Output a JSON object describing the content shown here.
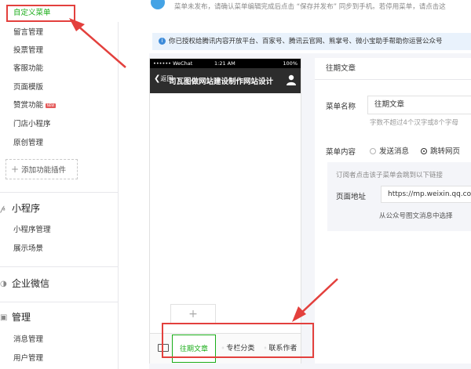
{
  "sidebar": {
    "items": [
      {
        "label": "自定义菜单",
        "active": true
      },
      {
        "label": "留言管理"
      },
      {
        "label": "投票管理"
      },
      {
        "label": "客服功能"
      },
      {
        "label": "页面模版"
      },
      {
        "label": "赞赏功能",
        "badge": "NEW"
      },
      {
        "label": "门店小程序"
      },
      {
        "label": "原创管理"
      }
    ],
    "add_plugin": "添加功能插件",
    "sections": [
      {
        "title": "小程序",
        "items": [
          "小程序管理",
          "展示场景"
        ]
      },
      {
        "title": "企业微信",
        "items": []
      },
      {
        "title": "管理",
        "items": [
          "消息管理",
          "用户管理"
        ]
      }
    ]
  },
  "notice": {
    "top": "菜单未发布，请确认菜单编辑完成后点击 “保存并发布” 同步到手机。若停用菜单，请点击这",
    "auth": "你已授权给腾讯内容开放平台、百家号、腾讯云官网、熊掌号、微小宝助手帮助你运营公众号"
  },
  "phone": {
    "status": {
      "carrier": "•••••• WeChat",
      "time": "1:21 AM",
      "battery": "100%"
    },
    "back": "返回",
    "title": "司瓦图做网站建设制作网站设计",
    "add_symbol": "+",
    "menu_tabs": [
      {
        "label": "往期文章",
        "active": true
      },
      {
        "label": "专栏分类",
        "active": false
      },
      {
        "label": "联系作者",
        "active": false
      }
    ]
  },
  "editor": {
    "header": "往期文章",
    "name_label": "菜单名称",
    "name_value": "往期文章",
    "name_hint": "字数不超过4个汉字或8个字母",
    "content_label": "菜单内容",
    "radio_send": "发送消息",
    "radio_jump": "跳转网页",
    "desc": "订阅者点击该子菜单会跳到以下链接",
    "page_addr_label": "页面地址",
    "url": "https://mp.weixin.qq.com",
    "from_article": "从公众号图文消息中选择"
  },
  "colors": {
    "accent_green": "#1aad19",
    "annotation_red": "#e3403d",
    "info_blue": "#44a3e5"
  }
}
